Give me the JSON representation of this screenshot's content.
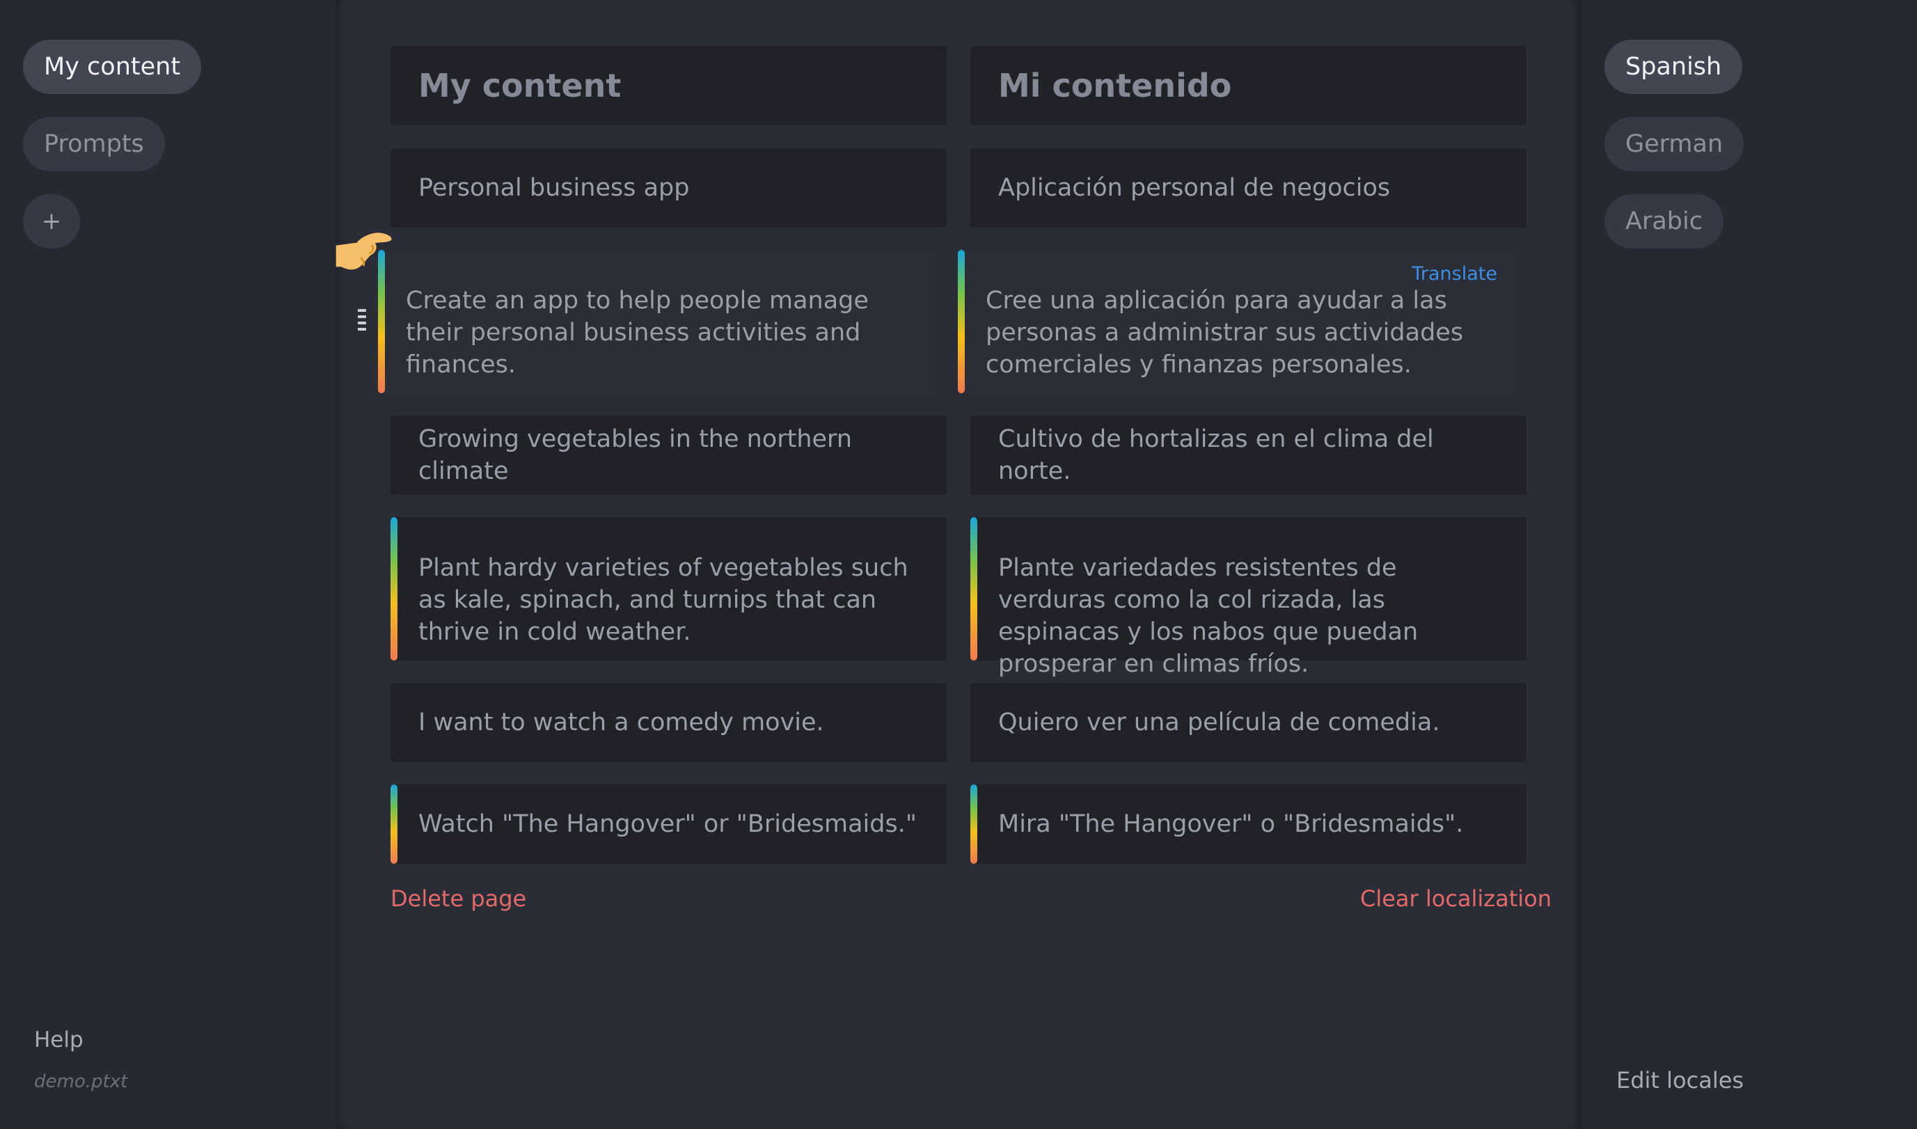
{
  "left_sidebar": {
    "items": [
      {
        "label": "My content"
      },
      {
        "label": "Prompts"
      }
    ],
    "add_label": "+",
    "help_label": "Help",
    "filename": "demo.ptxt"
  },
  "right_sidebar": {
    "locales": [
      {
        "label": "Spanish"
      },
      {
        "label": "German"
      },
      {
        "label": "Arabic"
      }
    ],
    "edit_label": "Edit locales"
  },
  "content": {
    "rows": [
      {
        "source": "My content",
        "target": "Mi contenido"
      },
      {
        "source": "Personal business app",
        "target": "Aplicación personal de negocios"
      },
      {
        "source": "Create an app to help people manage their personal business activities and finances.",
        "target": "Cree una aplicación para ayudar a las personas a administrar sus actividades comerciales y finanzas personales."
      },
      {
        "source": "Growing vegetables in the northern climate",
        "target": "Cultivo de hortalizas en el clima del norte."
      },
      {
        "source": "Plant hardy varieties of vegetables such as kale, spinach, and turnips that can thrive in cold weather.",
        "target": "Plante variedades resistentes de verduras como la col rizada, las espinacas y los nabos que puedan prosperar en climas fríos."
      },
      {
        "source": "I want to watch a comedy movie.",
        "target": "Quiero ver una película de comedia."
      },
      {
        "source": "Watch \"The Hangover\" or \"Bridesmaids.\"",
        "target": "Mira \"The Hangover\" o \"Bridesmaids\"."
      }
    ],
    "translate_label": "Translate",
    "delete_page_label": "Delete page",
    "clear_localization_label": "Clear localization"
  },
  "colors": {
    "accent_blue": "#3d8fe6",
    "danger_red": "#e46a6a",
    "prompt_bar_gradient": [
      "#1aa7d9",
      "#77c24c",
      "#f2c01b",
      "#f07a52"
    ]
  }
}
